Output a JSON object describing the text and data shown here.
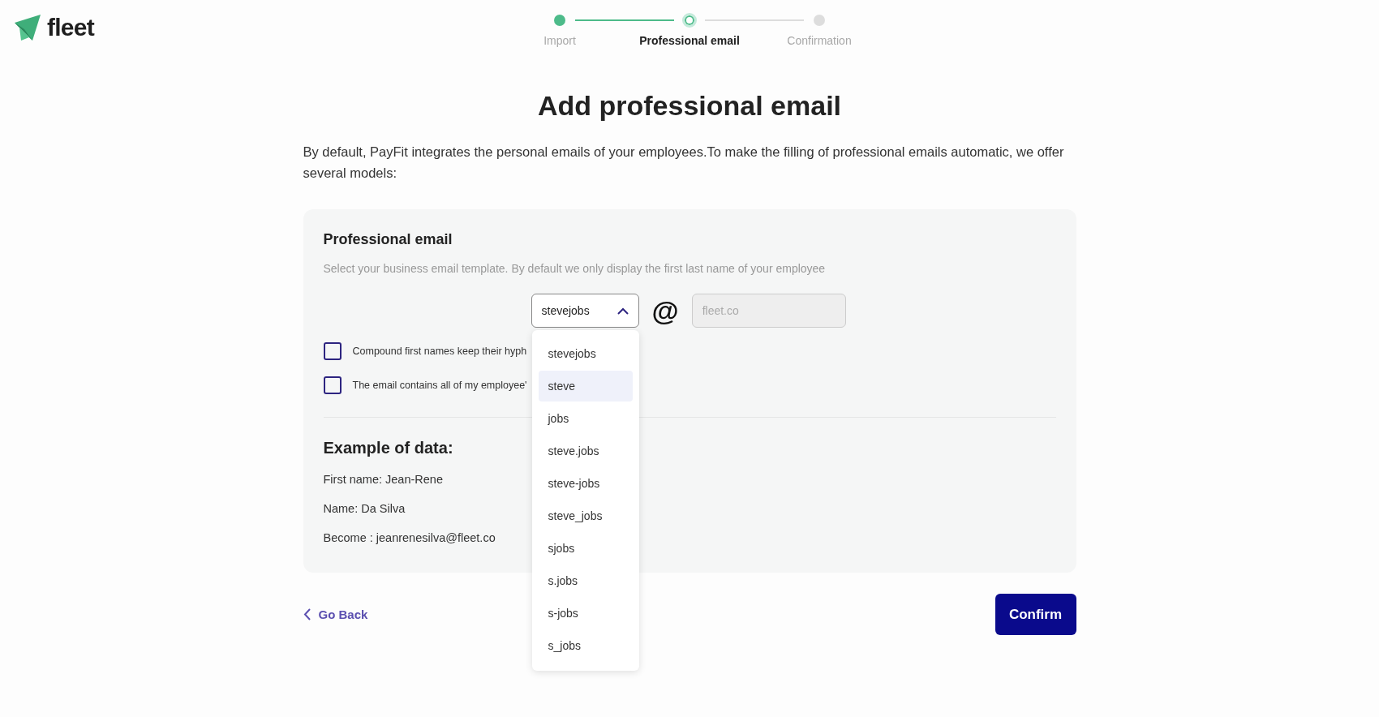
{
  "logo": {
    "text": "fleet"
  },
  "stepper": [
    {
      "label": "Import",
      "completed": true,
      "selected": false
    },
    {
      "label": "Professional email",
      "completed": false,
      "selected": true
    },
    {
      "label": "Confirmation",
      "completed": false,
      "selected": false
    }
  ],
  "title": "Add professional email",
  "intro": "By default, PayFit integrates the personal emails of your employees.To make the filling of professional emails automatic, we offer several models:",
  "card": {
    "heading": "Professional email",
    "helper": "Select your business email template. By default we only display the first last name of your employee",
    "template_select": {
      "value": "stevejobs",
      "expanded": true
    },
    "at_sign": "@",
    "domain_field": {
      "placeholder": "fleet.co",
      "disabled": true
    },
    "options": [
      {
        "label": "stevejobs",
        "selected": false
      },
      {
        "label": "steve",
        "selected": true
      },
      {
        "label": "jobs",
        "selected": false
      },
      {
        "label": "steve.jobs",
        "selected": false
      },
      {
        "label": "steve-jobs",
        "selected": false
      },
      {
        "label": "steve_jobs",
        "selected": false
      },
      {
        "label": "sjobs",
        "selected": false
      },
      {
        "label": "s.jobs",
        "selected": false
      },
      {
        "label": "s-jobs",
        "selected": false
      },
      {
        "label": "s_jobs",
        "selected": false
      }
    ],
    "checkboxes": [
      {
        "label": "Compound first names keep their hyph",
        "checked": false
      },
      {
        "label": "The email contains all of my employee'",
        "checked": false
      }
    ],
    "example_heading": "Example of data:",
    "example_lines": [
      "First name: Jean-Rene",
      "Name: Da Silva",
      "Become : jeanrenesilva@fleet.co"
    ]
  },
  "go_back": "Go Back",
  "confirm": "Confirm"
}
